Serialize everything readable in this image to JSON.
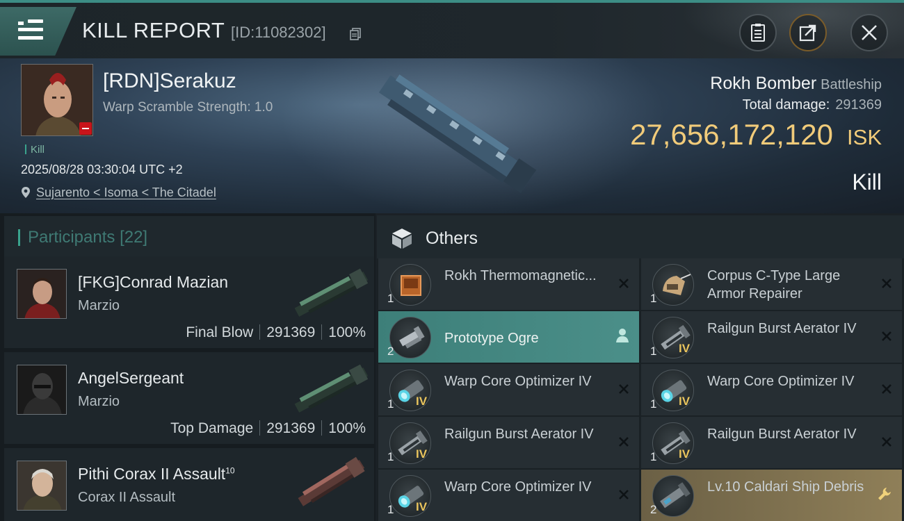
{
  "header": {
    "title": "KILL REPORT",
    "report_id": "[ID:11082302]",
    "icons": [
      "menu-icon",
      "copy-icon",
      "clipboard-icon",
      "share-icon",
      "close-icon"
    ],
    "accent_color": "#3c8d85"
  },
  "victim": {
    "name": "[RDN]Serakuz",
    "warp_scramble": "Warp Scramble Strength: 1.0",
    "kill_tag": "Kill",
    "datetime": "2025/08/28 03:30:04 UTC +2",
    "location": "Sujarento < Isoma < The Citadel",
    "ship_name": "Rokh Bomber",
    "ship_class": "Battleship",
    "total_damage_label": "Total damage:",
    "total_damage": "291369",
    "isk_value": "27,656,172,120",
    "isk_unit": "ISK",
    "result": "Kill",
    "isk_color": "#f1cb7a"
  },
  "participants": {
    "label": "Participants",
    "count": "[22]",
    "rows": [
      {
        "name": "[FKG]Conrad Mazian",
        "sup": "",
        "ship": "Marzio",
        "role": "Final Blow",
        "damage": "291369",
        "percent": "100%"
      },
      {
        "name": "AngelSergeant",
        "sup": "",
        "ship": "Marzio",
        "role": "Top Damage",
        "damage": "291369",
        "percent": "100%"
      },
      {
        "name": "Pithi Corax II Assault",
        "sup": "10",
        "ship": "Corax II Assault",
        "role": "",
        "damage": "",
        "percent": ""
      }
    ]
  },
  "others": {
    "label": "Others",
    "items": [
      {
        "name": "Rokh Thermomagnetic...",
        "qty": "1",
        "tier": "",
        "icon": "hull-plate-icon",
        "action": "close-icon"
      },
      {
        "name": "Corpus C-Type Large Armor Repairer",
        "qty": "1",
        "tier": "",
        "icon": "armor-repairer-icon",
        "action": "close-icon"
      },
      {
        "name": "Prototype  Ogre",
        "qty": "2",
        "tier": "",
        "icon": "drone-icon",
        "action": "pilot-icon"
      },
      {
        "name": "Railgun Burst Aerator IV",
        "qty": "1",
        "tier": "IV",
        "icon": "railgun-icon",
        "action": "close-icon"
      },
      {
        "name": "Warp Core Optimizer IV",
        "qty": "1",
        "tier": "IV",
        "icon": "warp-core-icon",
        "action": "close-icon"
      },
      {
        "name": "Warp Core Optimizer IV",
        "qty": "1",
        "tier": "IV",
        "icon": "warp-core-icon",
        "action": "close-icon"
      },
      {
        "name": "Railgun Burst Aerator IV",
        "qty": "1",
        "tier": "IV",
        "icon": "railgun-icon",
        "action": "close-icon"
      },
      {
        "name": "Railgun Burst Aerator IV",
        "qty": "1",
        "tier": "IV",
        "icon": "railgun-icon",
        "action": "close-icon"
      },
      {
        "name": "Warp Core Optimizer IV",
        "qty": "1",
        "tier": "IV",
        "icon": "warp-core-icon",
        "action": "close-icon"
      },
      {
        "name": "Lv.10 Caldari Ship Debris",
        "qty": "2",
        "tier": "",
        "icon": "debris-icon",
        "action": "wrench-icon"
      }
    ]
  }
}
